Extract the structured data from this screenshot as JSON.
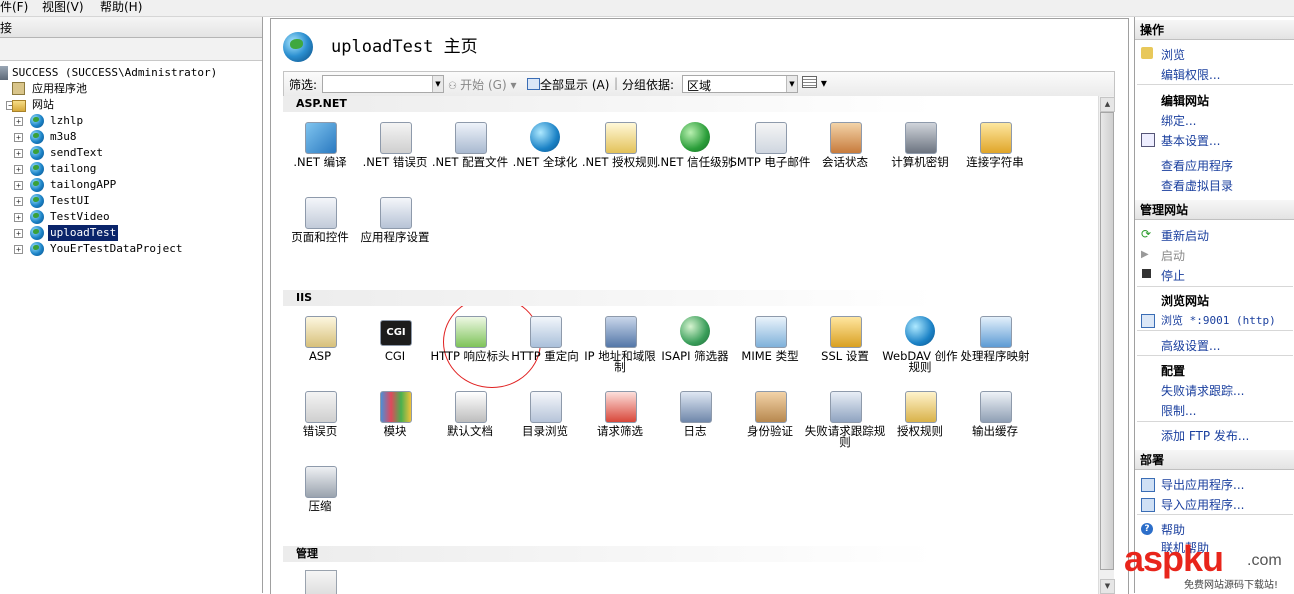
{
  "menubar": {
    "items": [
      "件(F)",
      "视图(V)",
      "帮助(H)"
    ]
  },
  "left": {
    "head": "接",
    "tree": [
      {
        "label": "SUCCESS (SUCCESS\\Administrator)",
        "icon": "server-icon"
      },
      {
        "label": "应用程序池",
        "icon": "app-pool-icon"
      },
      {
        "label": "网站",
        "icon": "sites-folder-icon"
      },
      {
        "label": "lzhlp",
        "icon": "globe-icon"
      },
      {
        "label": "m3u8",
        "icon": "globe-icon"
      },
      {
        "label": "sendText",
        "icon": "globe-icon"
      },
      {
        "label": "tailong",
        "icon": "globe-icon"
      },
      {
        "label": "tailongAPP",
        "icon": "globe-icon"
      },
      {
        "label": "TestUI",
        "icon": "globe-icon"
      },
      {
        "label": "TestVideo",
        "icon": "globe-icon"
      },
      {
        "label": "uploadTest",
        "icon": "globe-icon",
        "selected": true
      },
      {
        "label": "YouErTestDataProject",
        "icon": "globe-icon"
      }
    ]
  },
  "center": {
    "title": "uploadTest 主页",
    "filter": {
      "label": "筛选:",
      "go": "开始 (G)",
      "show_all": "全部显示 (A)",
      "group_by_label": "分组依据:",
      "group_by_value": "区域"
    },
    "groups": [
      {
        "name": "ASP.NET",
        "tiles": [
          {
            "label": ".NET 编译",
            "icon": "net-compile-icon"
          },
          {
            "label": ".NET 错误页",
            "icon": "net-error-pages-icon"
          },
          {
            "label": ".NET 配置文件",
            "icon": "net-profile-icon"
          },
          {
            "label": ".NET 全球化",
            "icon": "net-globalization-icon"
          },
          {
            "label": ".NET 授权规则",
            "icon": "net-authorization-icon"
          },
          {
            "label": ".NET 信任级别",
            "icon": "net-trust-levels-icon"
          },
          {
            "label": "SMTP 电子邮件",
            "icon": "smtp-email-icon"
          },
          {
            "label": "会话状态",
            "icon": "session-state-icon"
          },
          {
            "label": "计算机密钥",
            "icon": "machine-key-icon"
          },
          {
            "label": "连接字符串",
            "icon": "connection-strings-icon"
          },
          {
            "label": "页面和控件",
            "icon": "pages-controls-icon"
          },
          {
            "label": "应用程序设置",
            "icon": "app-settings-icon"
          }
        ]
      },
      {
        "name": "IIS",
        "tiles": [
          {
            "label": "ASP",
            "icon": "asp-icon"
          },
          {
            "label": "CGI",
            "icon": "cgi-icon"
          },
          {
            "label": "HTTP 响应标头",
            "icon": "http-response-headers-icon"
          },
          {
            "label": "HTTP 重定向",
            "icon": "http-redirect-icon"
          },
          {
            "label": "IP 地址和域限制",
            "icon": "ip-domain-restrictions-icon"
          },
          {
            "label": "ISAPI 筛选器",
            "icon": "isapi-filters-icon"
          },
          {
            "label": "MIME 类型",
            "icon": "mime-types-icon"
          },
          {
            "label": "SSL 设置",
            "icon": "ssl-settings-icon"
          },
          {
            "label": "WebDAV 创作规则",
            "icon": "webdav-icon"
          },
          {
            "label": "处理程序映射",
            "icon": "handler-mappings-icon"
          },
          {
            "label": "错误页",
            "icon": "error-pages-icon"
          },
          {
            "label": "模块",
            "icon": "modules-icon"
          },
          {
            "label": "默认文档",
            "icon": "default-document-icon"
          },
          {
            "label": "目录浏览",
            "icon": "directory-browsing-icon"
          },
          {
            "label": "请求筛选",
            "icon": "request-filtering-icon"
          },
          {
            "label": "日志",
            "icon": "logging-icon"
          },
          {
            "label": "身份验证",
            "icon": "authentication-icon"
          },
          {
            "label": "失败请求跟踪规则",
            "icon": "failed-request-tracing-icon"
          },
          {
            "label": "授权规则",
            "icon": "authorization-rules-icon"
          },
          {
            "label": "输出缓存",
            "icon": "output-caching-icon"
          },
          {
            "label": "压缩",
            "icon": "compression-icon"
          }
        ]
      },
      {
        "name": "管理",
        "tiles": []
      }
    ]
  },
  "right": {
    "header": "操作",
    "links1": [
      "浏览",
      "编辑权限..."
    ],
    "edit_site": "编辑网站",
    "links2": [
      "绑定...",
      "基本设置...",
      "查看应用程序",
      "查看虚拟目录"
    ],
    "manage_header": "管理网站",
    "manage": [
      "重新启动",
      "启动",
      "停止"
    ],
    "browse_sub": "浏览网站",
    "browse_link": "浏览 *:9001 (http)",
    "advanced": "高级设置...",
    "config_sub": "配置",
    "config_links": [
      "失败请求跟踪...",
      "限制..."
    ],
    "ftp": "添加 FTP 发布...",
    "deploy_header": "部署",
    "deploy": [
      "导出应用程序...",
      "导入应用程序..."
    ],
    "help": "帮助",
    "online_help": "联机帮助"
  },
  "watermark": {
    "brand": "aspku",
    "tld": ".com",
    "tagline": "免费网站源码下载站!"
  }
}
